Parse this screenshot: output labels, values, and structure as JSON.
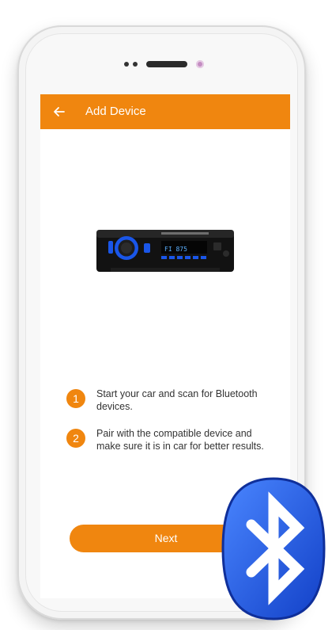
{
  "app_bar": {
    "title": "Add Device",
    "back_icon": "arrow-left-icon",
    "color": "#f0860f"
  },
  "device_image": {
    "display_text": "FI 875"
  },
  "steps": [
    {
      "number": "1",
      "text": "Start your car and scan for Bluetooth devices."
    },
    {
      "number": "2",
      "text": "Pair with the compatible device and make sure it is in car for better results."
    }
  ],
  "next_button": {
    "label": "Next"
  },
  "overlay_icon": "bluetooth-icon",
  "colors": {
    "accent": "#f0860f",
    "bluetooth_blue": "#1a56e8"
  }
}
